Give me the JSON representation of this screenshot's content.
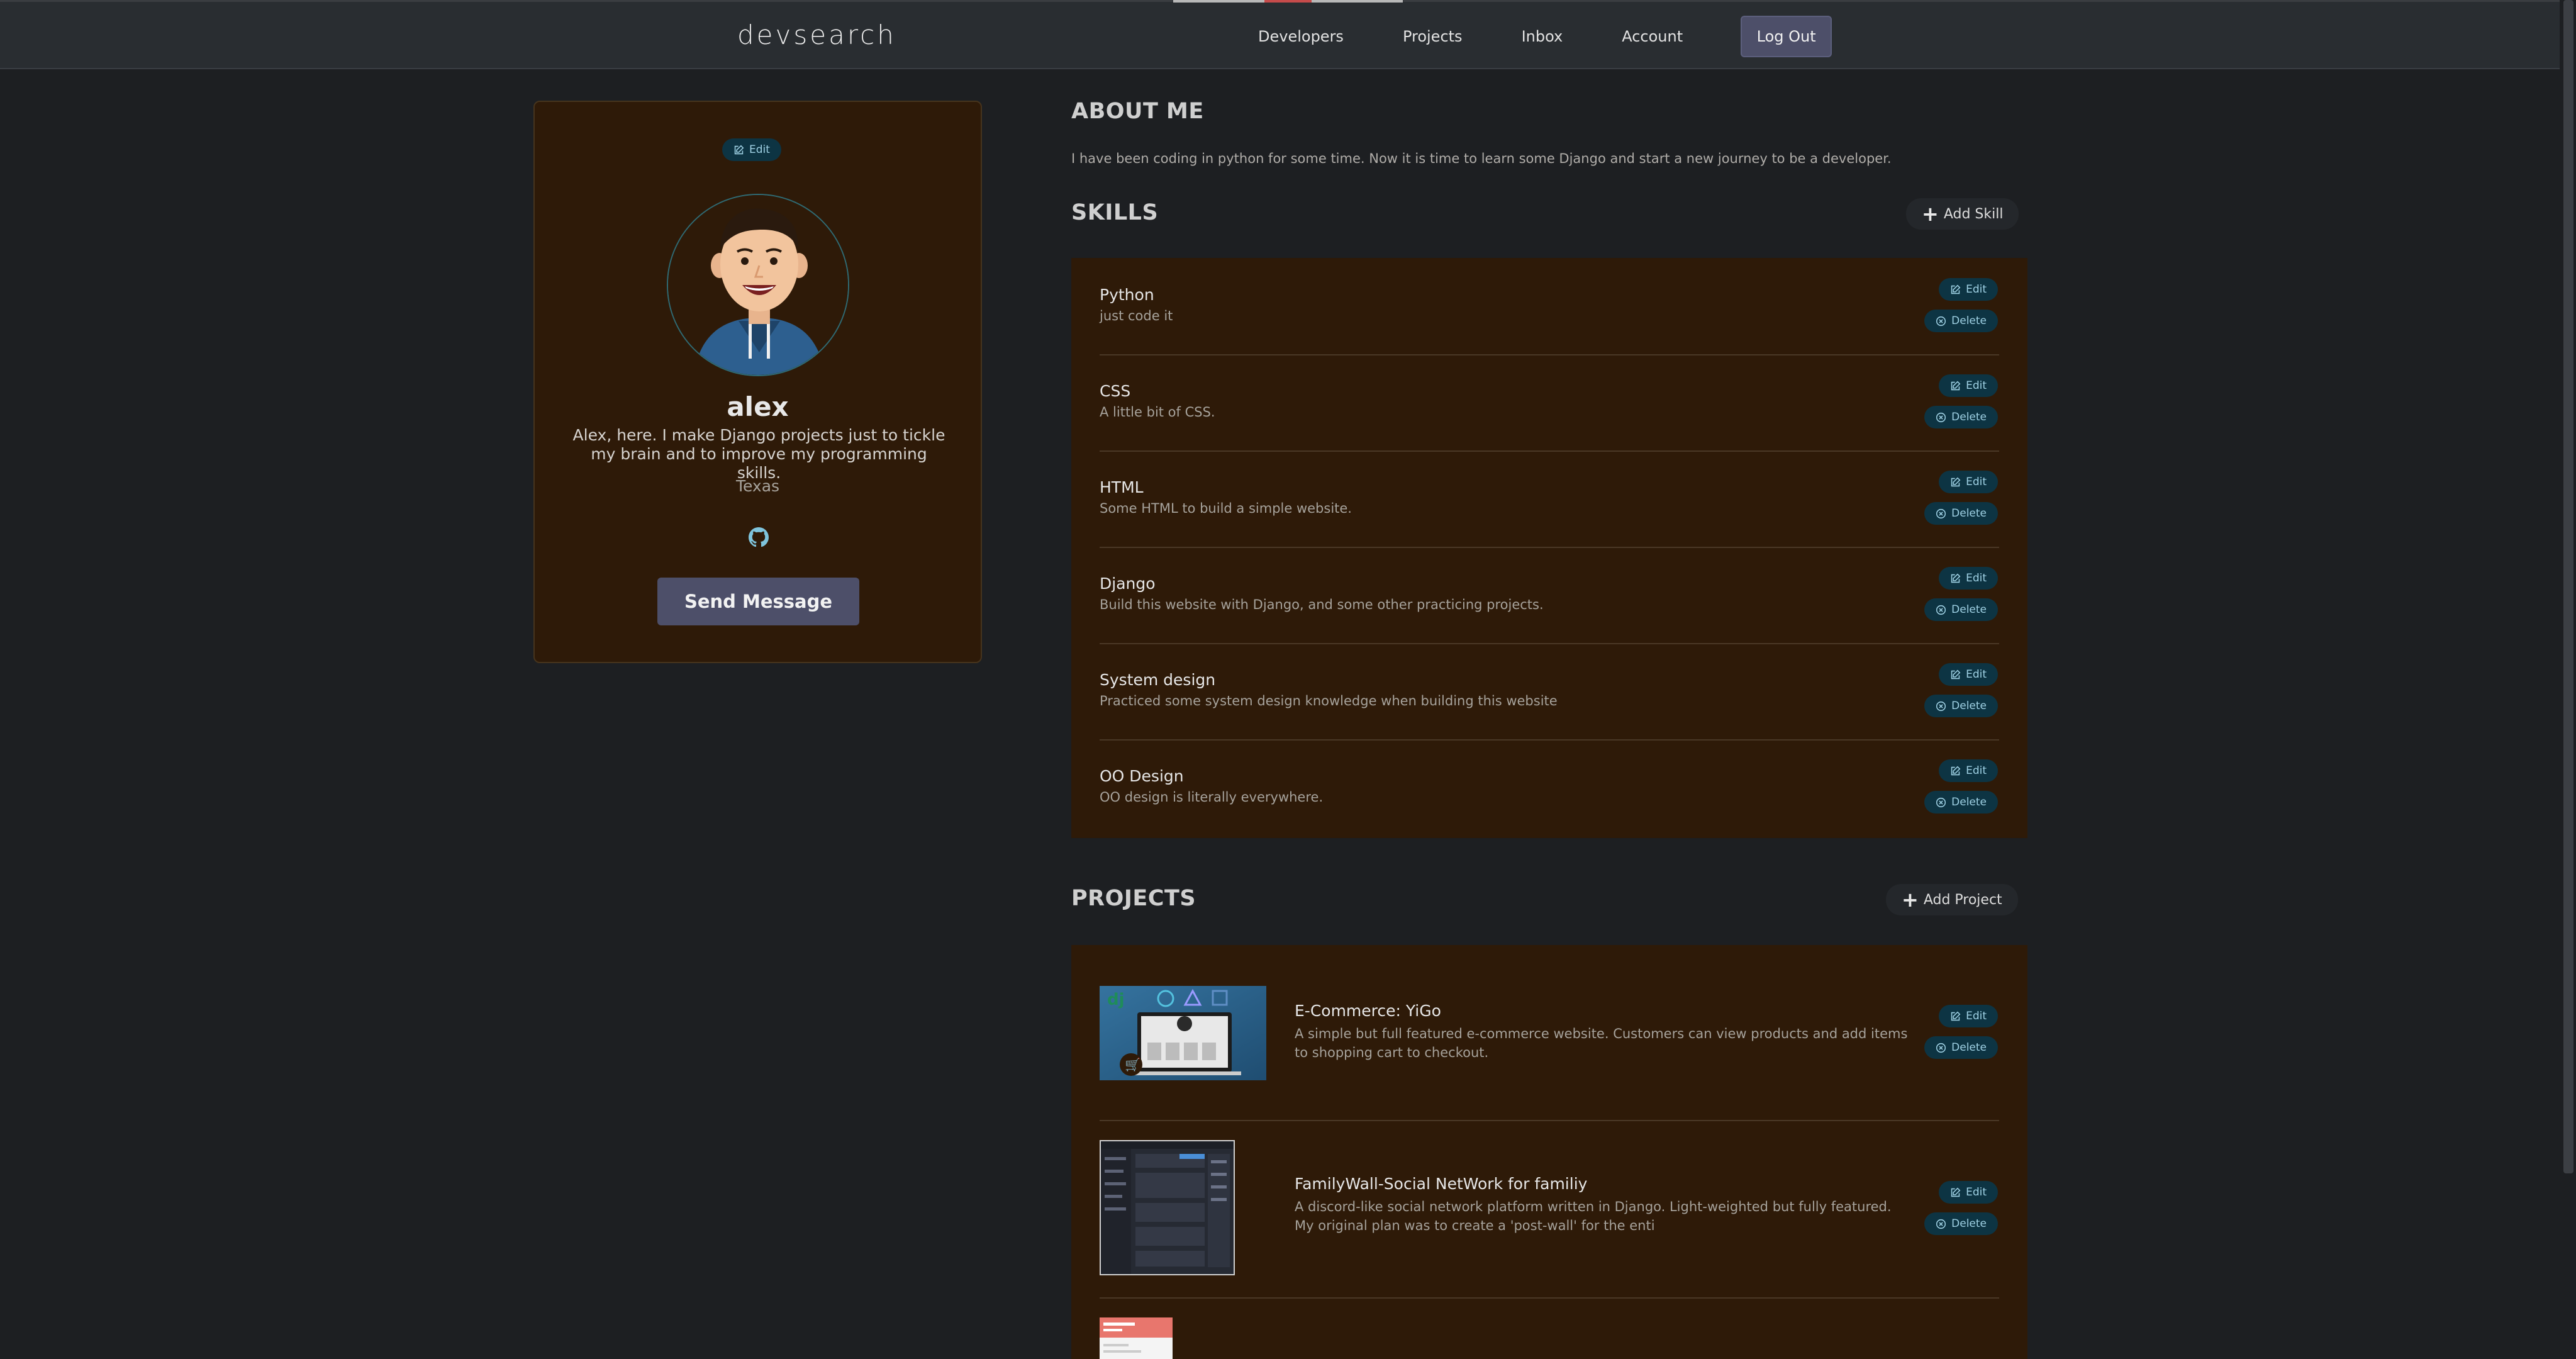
{
  "header": {
    "logo": "devsearch",
    "nav": [
      "Developers",
      "Projects",
      "Inbox",
      "Account"
    ],
    "logout": "Log Out"
  },
  "profile": {
    "edit_label": "Edit",
    "name": "alex",
    "bio": "Alex, here. I make Django projects just to tickle my brain and to improve my programming skills.",
    "location": "Texas",
    "send_message": "Send Message",
    "social_icon": "github-icon"
  },
  "about": {
    "title": "ABOUT ME",
    "text": "I have been coding in python for some time. Now it is time to learn some Django and start a new journey to be a developer."
  },
  "skills": {
    "title": "SKILLS",
    "add_label": "Add Skill",
    "edit_label": "Edit",
    "delete_label": "Delete",
    "items": [
      {
        "name": "Python",
        "desc": "just code it"
      },
      {
        "name": "CSS",
        "desc": "A little bit of CSS."
      },
      {
        "name": "HTML",
        "desc": "Some HTML to build a simple website."
      },
      {
        "name": "Django",
        "desc": "Build this website with Django, and some other practicing projects."
      },
      {
        "name": "System design",
        "desc": "Practiced some system design knowledge when building this website"
      },
      {
        "name": "OO Design",
        "desc": "OO design is literally everywhere."
      }
    ]
  },
  "projects": {
    "title": "PROJECTS",
    "add_label": "Add Project",
    "edit_label": "Edit",
    "delete_label": "Delete",
    "items": [
      {
        "title": "E-Commerce: YiGo",
        "desc": "A simple but full featured e-commerce website. Customers can view products and add items to shopping cart to checkout."
      },
      {
        "title": "FamilyWall-Social NetWork for familiy",
        "desc": "A discord-like social network platform written in Django. Light-weighted but fully featured. My original plan was to create a 'post-wall' for the enti"
      }
    ]
  },
  "colors": {
    "background": "#1d1f22",
    "card": "#2e1a08",
    "accent_button": "#0d3443",
    "primary_button": "#4d4f69"
  }
}
